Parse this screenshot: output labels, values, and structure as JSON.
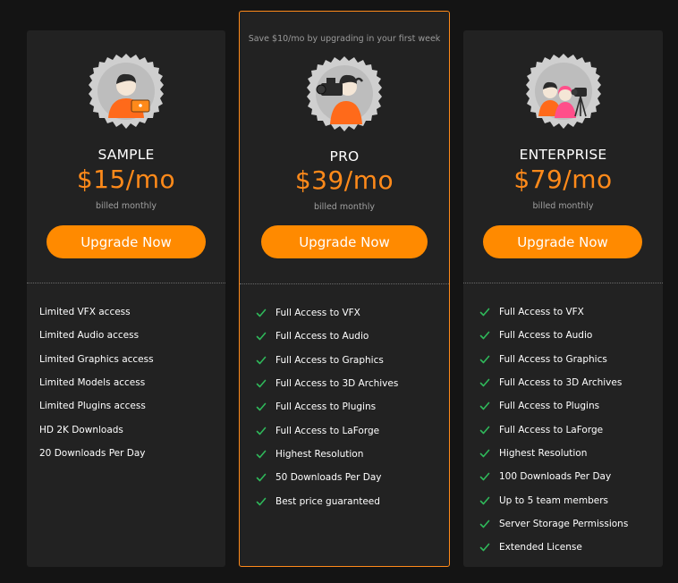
{
  "colors": {
    "background": "#141414",
    "card": "#222222",
    "accent": "#ff8a00",
    "check": "#2fb85a"
  },
  "plans": [
    {
      "id": "sample",
      "name": "SAMPLE",
      "price": "$15/mo",
      "billing": "billed monthly",
      "cta_label": "Upgrade Now",
      "badge_icon": "person-with-laptop-icon",
      "features": [
        "Limited VFX access",
        "Limited Audio access",
        "Limited Graphics access",
        "Limited Models access",
        "Limited Plugins access",
        "HD 2K Downloads",
        "20 Downloads Per Day"
      ]
    },
    {
      "id": "pro",
      "promo": "Save $10/mo by upgrading in your first week",
      "name": "PRO",
      "price": "$39/mo",
      "billing": "billed monthly",
      "cta_label": "Upgrade Now",
      "badge_icon": "camera-operator-icon",
      "features": [
        "Full Access to VFX",
        "Full Access to Audio",
        "Full Access to Graphics",
        "Full Access to 3D Archives",
        "Full Access to Plugins",
        "Full Access to LaForge",
        "Highest Resolution",
        "50 Downloads Per Day",
        "Best price guaranteed"
      ]
    },
    {
      "id": "enterprise",
      "name": "ENTERPRISE",
      "price": "$79/mo",
      "billing": "billed monthly",
      "cta_label": "Upgrade Now",
      "badge_icon": "film-crew-icon",
      "features": [
        "Full Access to VFX",
        "Full Access to Audio",
        "Full Access to Graphics",
        "Full Access to 3D Archives",
        "Full Access to Plugins",
        "Full Access to LaForge",
        "Highest Resolution",
        "100 Downloads Per Day",
        "Up to 5 team members",
        "Server Storage Permissions",
        "Extended License"
      ]
    }
  ]
}
